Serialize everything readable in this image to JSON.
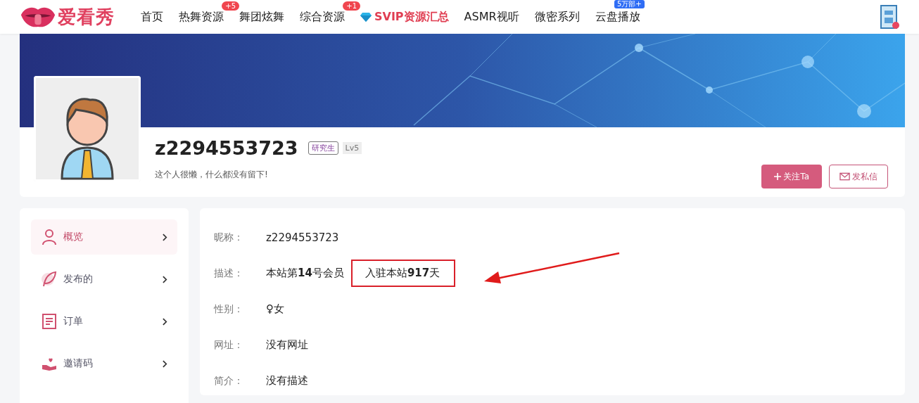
{
  "header": {
    "logo_text": "爱看秀",
    "nav": [
      {
        "label": "首页",
        "kind": "plain"
      },
      {
        "label": "热舞资源",
        "kind": "plain",
        "badge": "+5",
        "color": "#f0464f"
      },
      {
        "label": "舞团炫舞",
        "kind": "plain"
      },
      {
        "label": "综合资源",
        "kind": "plain",
        "badge": "+1",
        "color": "#f0464f"
      },
      {
        "label": "SVIP资源汇总",
        "kind": "vip"
      },
      {
        "label": "ASMR视听",
        "kind": "plain"
      },
      {
        "label": "微密系列",
        "kind": "plain"
      },
      {
        "label": "云盘播放",
        "kind": "top_badge",
        "badge": "5万部+",
        "color": "#2f6df5"
      }
    ]
  },
  "profile": {
    "name": "z2294553723",
    "role_tag": "研究生",
    "level_tag": "Lv5",
    "signature": "这个人很懒，什么都没有留下!",
    "buttons": [
      {
        "label": "关注Ta",
        "kind": "primary"
      },
      {
        "label": "发私信",
        "kind": "outline"
      }
    ]
  },
  "sidebar": {
    "items": [
      {
        "label": "概览",
        "selected": true
      },
      {
        "label": "发布的",
        "selected": false
      },
      {
        "label": "订单",
        "selected": false
      },
      {
        "label": "邀请码",
        "selected": false
      }
    ]
  },
  "details": [
    {
      "label": "昵称：",
      "values": [
        {
          "text": "z2294553723",
          "highlighted": false
        }
      ]
    },
    {
      "label": "描述：",
      "values": [
        {
          "text": "本站第**14**号会员",
          "highlighted": false
        },
        {
          "text": "入驻本站**917**天",
          "highlighted": true
        }
      ]
    },
    {
      "label": "性别：",
      "values": [
        {
          "text": "♀女",
          "highlighted": false
        }
      ]
    },
    {
      "label": "网址：",
      "values": [
        {
          "text": "没有网址",
          "highlighted": false
        }
      ]
    },
    {
      "label": "简介：",
      "values": [
        {
          "text": "没有描述",
          "highlighted": false
        }
      ]
    }
  ]
}
